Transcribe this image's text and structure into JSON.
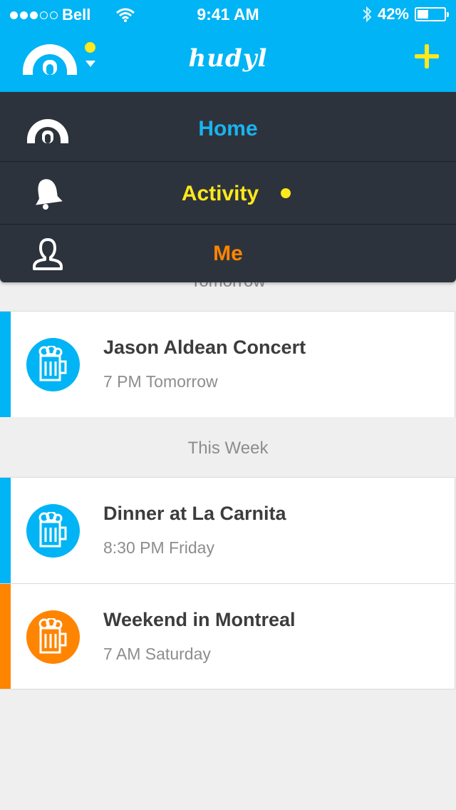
{
  "status_bar": {
    "carrier": "Bell",
    "time": "9:41 AM",
    "battery": "42%",
    "battery_level": 0.42,
    "icons": [
      "signal-dots-icon",
      "wifi-icon",
      "bluetooth-icon",
      "battery-icon"
    ]
  },
  "nav_bar": {
    "title": "hudyl",
    "logo_icon": "hudyl-arch-icon",
    "add_icon": "plus-icon"
  },
  "menu": {
    "items": [
      {
        "label": "Home",
        "icon": "arch-icon",
        "color": "#18b4f0"
      },
      {
        "label": "Activity",
        "icon": "bell-icon",
        "color": "#ffe81c",
        "badge": true
      },
      {
        "label": "Me",
        "icon": "person-icon",
        "color": "#ff8400"
      }
    ]
  },
  "feed": {
    "sections": [
      {
        "header": "Tomorrow",
        "events": [
          {
            "title": "Jason Aldean Concert",
            "time": "7 PM Tomorrow",
            "color": "#00b4f5",
            "icon": "beer-mug-icon"
          }
        ]
      },
      {
        "header": "This Week",
        "events": [
          {
            "title": "Dinner at La Carnita",
            "time": "8:30 PM Friday",
            "color": "#00b4f5",
            "icon": "beer-mug-icon"
          },
          {
            "title": "Weekend in Montreal",
            "time": "7 AM Saturday",
            "color": "#ff8400",
            "icon": "beer-mug-icon"
          }
        ]
      }
    ]
  },
  "colors": {
    "brand_blue": "#00b4f5",
    "accent_yellow": "#ffe81c",
    "accent_orange": "#ff8400",
    "menu_background": "#2d333c"
  }
}
